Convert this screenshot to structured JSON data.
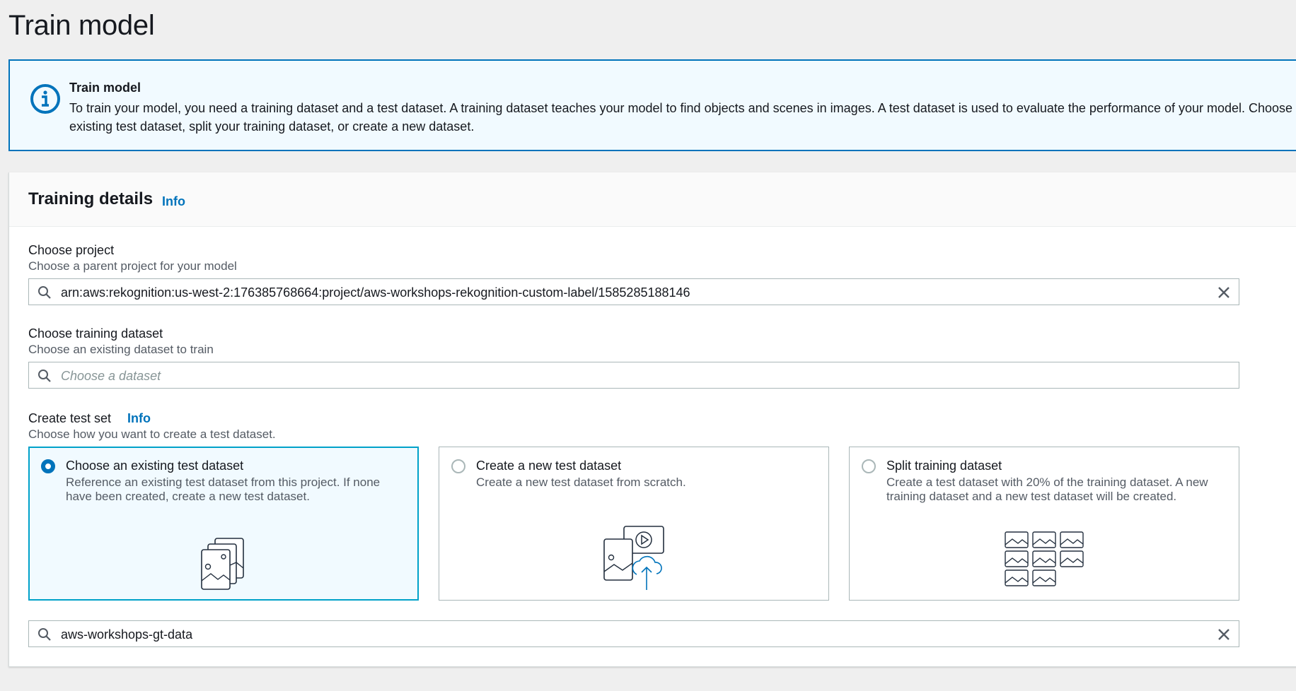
{
  "page": {
    "title": "Train model"
  },
  "alert": {
    "title": "Train model",
    "body": "To train your model, you need a training dataset and a test dataset. A training dataset teaches your model to find objects and scenes in images. A test dataset is used to evaluate the performance of your model. Choose an existing test dataset, split your training dataset, or create a new dataset."
  },
  "training_details": {
    "title": "Training details",
    "info": "Info",
    "project": {
      "label": "Choose project",
      "description": "Choose a parent project for your model",
      "value": "arn:aws:rekognition:us-west-2:176385768664:project/aws-workshops-rekognition-custom-label/1585285188146"
    },
    "training_dataset": {
      "label": "Choose training dataset",
      "description": "Choose an existing dataset to train",
      "placeholder": "Choose a dataset"
    },
    "test_set": {
      "label": "Create test set",
      "info": "Info",
      "description": "Choose how you want to create a test dataset.",
      "options": [
        {
          "title": "Choose an existing test dataset",
          "description": "Reference an existing test dataset from this project. If none have been created, create a new test dataset.",
          "selected": true
        },
        {
          "title": "Create a new test dataset",
          "description": "Create a new test dataset from scratch.",
          "selected": false
        },
        {
          "title": "Split training dataset",
          "description": "Create a test dataset with 20% of the training dataset. A new training dataset and a new test dataset will be created.",
          "selected": false
        }
      ],
      "selected_dataset": "aws-workshops-gt-data"
    }
  },
  "colors": {
    "accent": "#0073bb",
    "selected_border": "#00a1c9",
    "alert_bg": "#f1faff"
  }
}
